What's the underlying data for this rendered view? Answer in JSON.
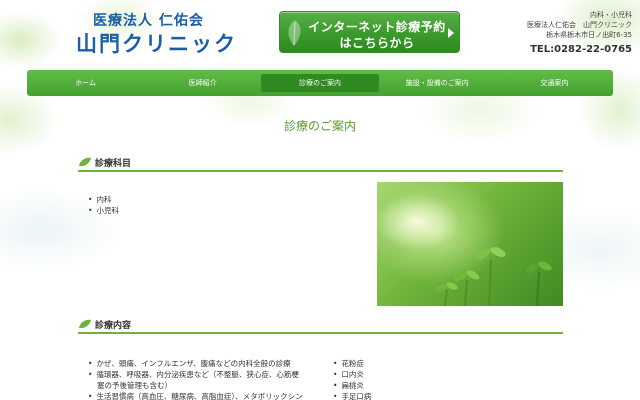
{
  "header": {
    "logo_sub": "医療法人 仁佑会",
    "logo_main": "山門クリニック",
    "reserve_line1": "インターネット診療予約",
    "reserve_line2": "はこちらから",
    "info_line1": "内科・小児科",
    "info_line2": "医療法人仁佑会　山門クリニック",
    "info_line3": "栃木県栃木市日ノ出町6-35",
    "tel": "TEL:0282-22-0765"
  },
  "nav": {
    "items": [
      {
        "label": "ホーム"
      },
      {
        "label": "医師紹介"
      },
      {
        "label": "診療のご案内"
      },
      {
        "label": "施設・設備のご案内"
      },
      {
        "label": "交通案内"
      }
    ],
    "active_index": 2
  },
  "page": {
    "title": "診療のご案内"
  },
  "sections": {
    "subjects": {
      "heading": "診療科目",
      "items": [
        "内科",
        "小児科"
      ]
    },
    "content": {
      "heading": "診療内容",
      "left_items": [
        "かぜ、頭痛、インフルエンザ、腹痛などの内科全般の診療",
        "循環器、呼吸器、内分泌疾患など（不整脈、狭心症、心筋梗",
        "塞の予後管理も含む）",
        "生活習慣病（高血圧、糖尿病、高脂血症）、メタボリックシン"
      ],
      "right_items": [
        "花粉症",
        "口内炎",
        "扁桃炎",
        "手足口病"
      ]
    }
  },
  "colors": {
    "brand_blue": "#1d5ea8",
    "nav_green": "#43a22f",
    "accent_green": "#6db33f",
    "title_green": "#5a9a2b"
  }
}
